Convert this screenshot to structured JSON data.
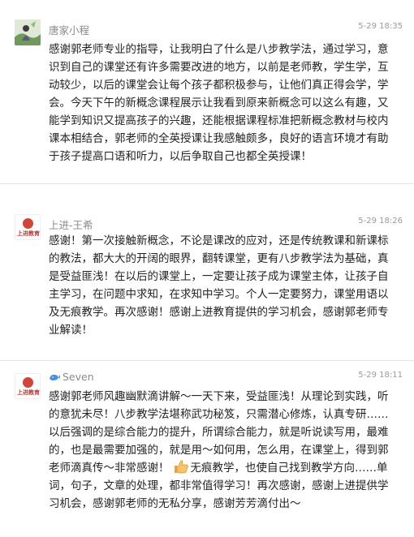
{
  "comments": [
    {
      "name": "唐家小程",
      "time": "5-29 18:35",
      "avatar": "user-photo",
      "text": "感谢郭老师专业的指导，让我明白了什么是八步教学法，通过学习，意识到自己的课堂还有许多需要改进的地方，以前是老师教，学生学，互动较少，以后的课堂会让每个孩子都积极参与，让他们真正得会学，学会。今天下午的新概念课程展示让我看到原来新概念可以这么有趣，又能学到知识又提高孩子的兴趣，还能根据课程标准把新概念教材与校内课本相结合，郭老师的全英授课让我感触颇多，良好的语言环境才有助于孩子提高口语和听力，以后争取自己也都全英授课！"
    },
    {
      "name": "上进-王希",
      "time": "5-29 18:26",
      "avatar": "shangjin-logo",
      "avatar_label": "上进教育",
      "text": "感谢！第一次接触新概念，不论是课改的应对，还是传统教课和新课标的教法，都大大的开阔的眼界，翻转课堂，更有八步教学法为基础，真是受益匪浅！在以后的课堂上，一定要让孩子成为课堂主体，让孩子自主学习，在问题中求知，在求知中学习。个人一定要努力，课堂用语以及无痕教学。再次感谢！感谢上进教育提供的学习机会，感谢郭老师专业解读！"
    },
    {
      "name": "Seven",
      "time": "5-29 18:11",
      "avatar": "shangjin-logo",
      "avatar_label": "上进教育",
      "name_icon": "whale-icon",
      "text_before_emoji": "感谢郭老师风趣幽默滴讲解～一天下来，受益匪浅！从理论到实践，听的意犹未尽！八步教学法堪称武功秘笈，只需潜心修炼，认真专研……以后强调的是综合能力的提升，所谓综合能力，就是听说读写用，最难的，也是最需要加强的，就是用～如何用，怎么用，在课堂上，得到郭老师滴真传～非常感谢！",
      "emoji": "thumbs-up-icon",
      "text_after_emoji": "无痕教学，也使自己找到教学方向……单词，句子，文章的处理，都非常值得学习！再次感谢，感谢上进提供学习机会，感谢郭老师的无私分享，感谢芳芳滴付出～"
    }
  ]
}
